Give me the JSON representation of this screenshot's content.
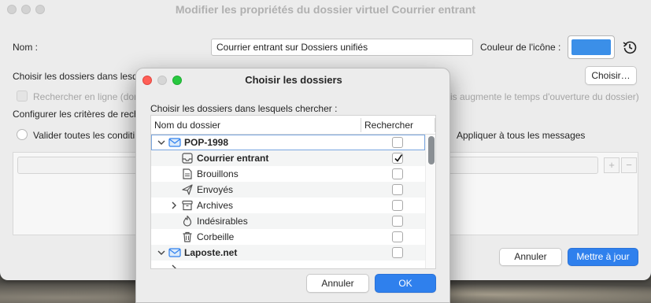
{
  "main_window": {
    "title": "Modifier les propriétés du dossier virtuel Courrier entrant",
    "name_label": "Nom :",
    "name_value": "Courrier entrant sur Dossiers unifiés",
    "icon_color_label": "Couleur de l'icône :",
    "icon_color": "#3b8fe8",
    "choose_folders_label": "Choisir les dossiers dans lesq",
    "choose_button": "Choisir…",
    "search_online_label": "Rechercher en ligne (don",
    "search_online_suffix": "is augmente le temps d'ouverture du dossier)",
    "configure_criteria_label": "Configurer les critères de rech",
    "match_all_label": "Valider toutes les conditi",
    "apply_all_label": "Appliquer à tous les messages",
    "plus": "+",
    "minus": "−",
    "cancel_button": "Annuler",
    "update_button": "Mettre à jour"
  },
  "dialog": {
    "title": "Choisir les dossiers",
    "instruction": "Choisir les dossiers dans lesquels chercher :",
    "columns": {
      "name": "Nom du dossier",
      "search": "Rechercher"
    },
    "rows": [
      {
        "label": "POP-1998",
        "icon": "account-icon",
        "checked": false
      },
      {
        "label": "Courrier entrant",
        "icon": "inbox-icon",
        "checked": true
      },
      {
        "label": "Brouillons",
        "icon": "drafts-icon",
        "checked": false
      },
      {
        "label": "Envoyés",
        "icon": "sent-icon",
        "checked": false
      },
      {
        "label": "Archives",
        "icon": "archives-icon",
        "checked": false
      },
      {
        "label": "Indésirables",
        "icon": "junk-icon",
        "checked": false
      },
      {
        "label": "Corbeille",
        "icon": "trash-icon",
        "checked": false
      },
      {
        "label": "Laposte.net",
        "icon": "account-icon",
        "checked": false
      }
    ],
    "cancel_button": "Annuler",
    "ok_button": "OK"
  },
  "colors": {
    "accent": "#2f80ed",
    "close": "#ff5f57",
    "minimize": "#d6d6d6",
    "zoom": "#28c840"
  }
}
